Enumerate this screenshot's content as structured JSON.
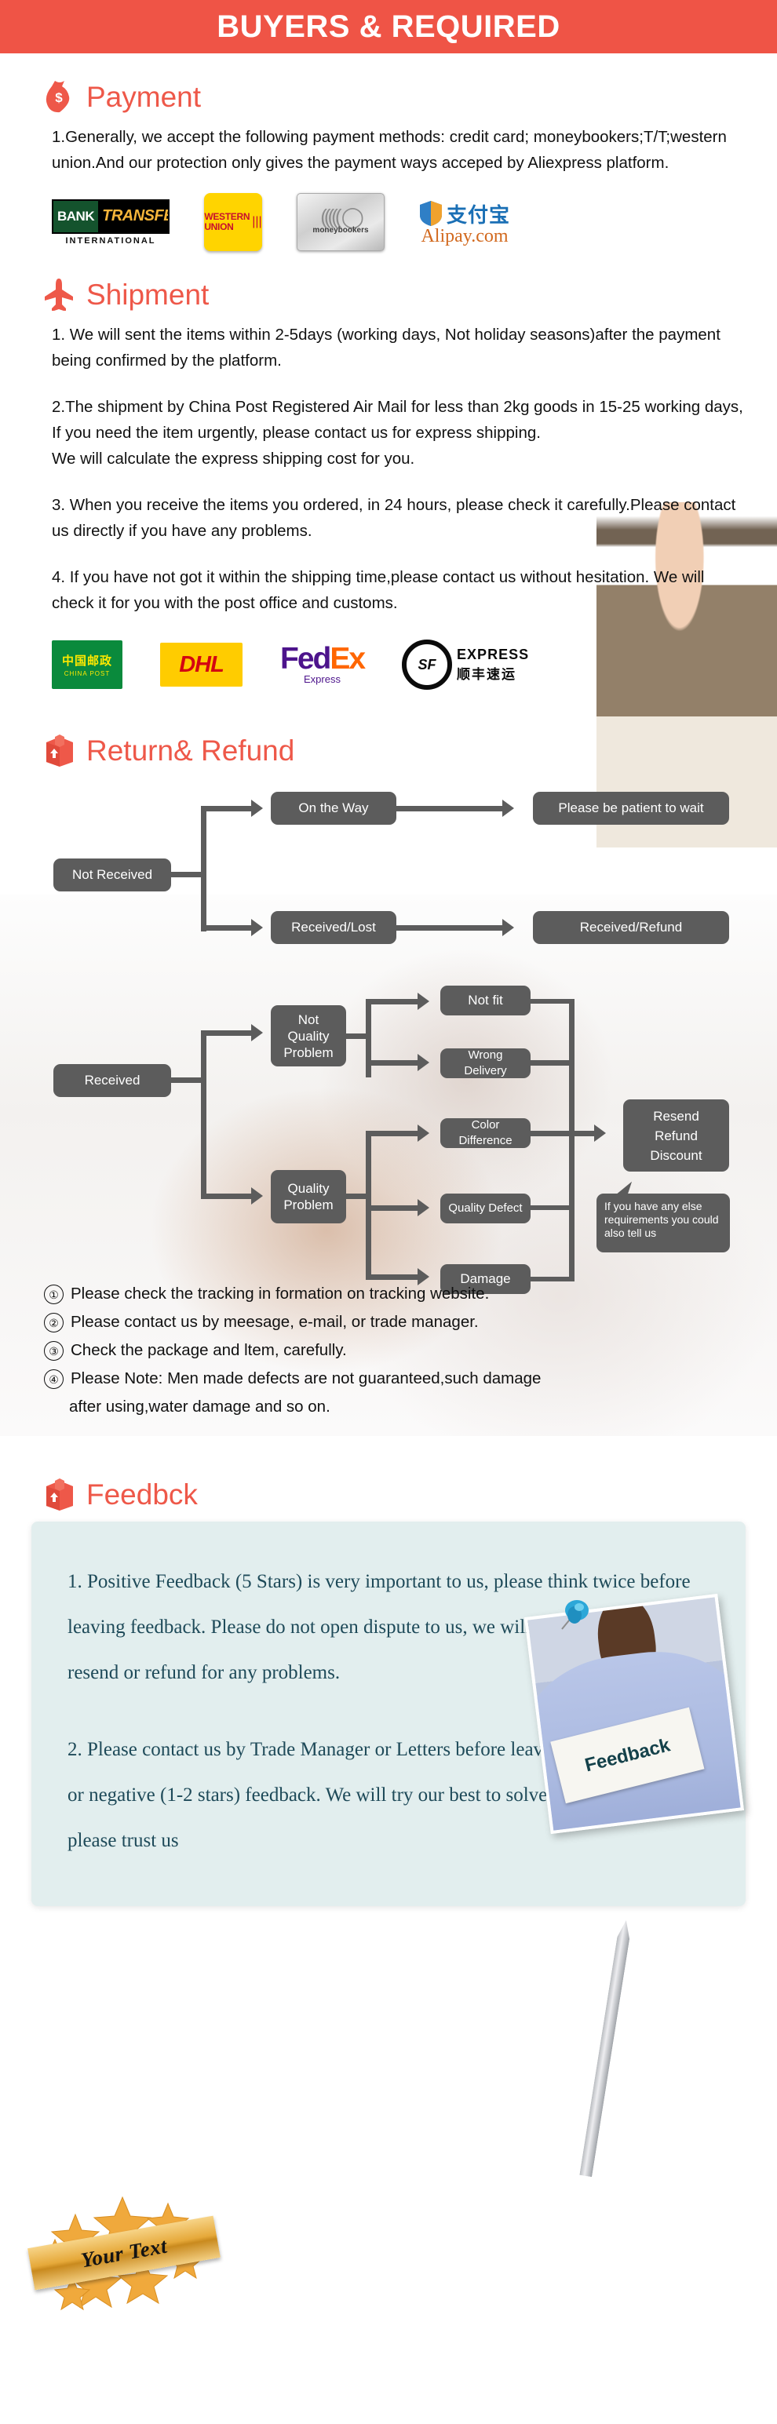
{
  "header": {
    "title": "BUYERS & REQUIRED",
    "bg_color": "#ef5446"
  },
  "sections": {
    "payment": {
      "icon": "money-bag-icon",
      "title": "Payment",
      "paragraphs": [
        "1.Generally, we accept the following payment methods: credit card; moneybookers;T/T;western union.And our protection only gives the payment ways acceped by Aliexpress platform."
      ],
      "logos": [
        {
          "name": "bank-transfer-logo",
          "line1a": "BANK",
          "line1b": "TRANSFER",
          "line2": "INTERNATIONAL"
        },
        {
          "name": "western-union-logo",
          "line1": "WESTERN",
          "line2": "UNION"
        },
        {
          "name": "moneybookers-logo",
          "label": "moneybookers"
        },
        {
          "name": "alipay-logo",
          "cn": "支付宝",
          "label": "Alipay.com"
        }
      ]
    },
    "shipment": {
      "icon": "airplane-icon",
      "title": "Shipment",
      "paragraphs": [
        "1. We will sent the items within 2-5days (working days, Not holiday seasons)after the payment being confirmed by the platform.",
        "2.The shipment by China Post Registered Air Mail for less than  2kg goods in 15-25 working days, If  you need the item urgently, please contact us for express shipping.",
        "We will calculate the express shipping cost for you.",
        "3. When you receive the items you ordered, in 24 hours, please check it carefully.Please contact us directly if you have any problems.",
        "4. If you have not got it within the shipping time,please contact us without hesitation. We will check it for you with the post office and customs."
      ],
      "logos": [
        {
          "name": "china-post-logo",
          "cn": "中国邮政",
          "label": "CHINA POST"
        },
        {
          "name": "dhl-logo",
          "label": "DHL"
        },
        {
          "name": "fedex-logo",
          "a": "Fed",
          "b": "Ex",
          "sub": "Express"
        },
        {
          "name": "sf-express-logo",
          "mark": "SF",
          "label": "EXPRESS",
          "cn": "顺丰速运"
        }
      ]
    },
    "return_refund": {
      "icon": "box-return-icon",
      "title": "Return& Refund",
      "flowchart": {
        "boxes": {
          "not_received": "Not Received",
          "on_the_way": "On the Way",
          "please_wait": "Please be patient to wait",
          "received_lost": "Received/Lost",
          "received_refund": "Received/Refund",
          "received": "Received",
          "not_quality_problem": "Not Quality Problem",
          "quality_problem": "Quality Problem",
          "not_fit": "Not fit",
          "wrong_delivery": "Wrong Delivery",
          "color_difference": "Color Difference",
          "quality_defect": "Quality Defect",
          "damage": "Damage",
          "resend_refund_discount": "Resend Refund Discount"
        },
        "callout": "If you have any else requirements you could also tell us"
      },
      "notes": [
        {
          "num": "①",
          "text": "Please check the tracking in formation on tracking website."
        },
        {
          "num": "②",
          "text": "Please contact us by meesage, e-mail, or trade manager."
        },
        {
          "num": "③",
          "text": "Check the package and ltem, carefully."
        },
        {
          "num": "④",
          "text": "Please Note: Men made defects  are not guaranteed,such damage",
          "cont": "after using,water damage and so on."
        }
      ]
    },
    "feedback": {
      "icon": "box-return-icon",
      "title": "Feedbck",
      "photo_sign_text": "Feedback",
      "paragraphs": [
        "1. Positive Feedback (5 Stars) is very important to us, please think twice before leaving feedback. Please do not open dispute to us,   we will take responsibility to resend or refund for any problems.",
        "2. Please contact us by Trade Manager or Letters before leaving neutral(3 stars) or negative (1-2 stars) feedback. We will try our best to solve the problems and please trust us"
      ],
      "panel_bg": "#e2eeee",
      "text_color": "#1e4a59"
    }
  },
  "badge": {
    "name": "your-text-star-badge",
    "label": "Your Text"
  }
}
